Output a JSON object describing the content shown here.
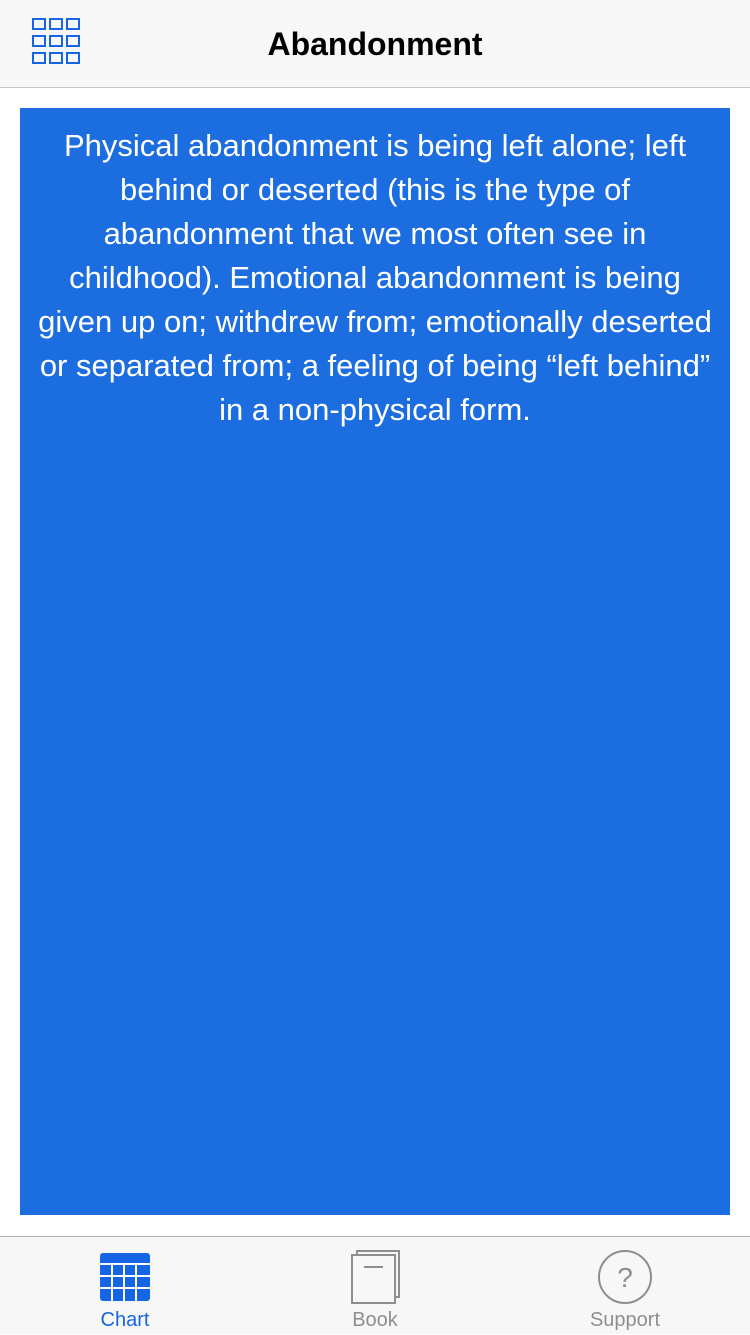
{
  "navbar": {
    "title": "Abandonment",
    "menu_icon": "grid-icon"
  },
  "content": {
    "description": "Physical abandonment is being left alone; left behind or deserted (this is the type of abandonment that we most often see in childhood). Emotional abandonment is being given up on; withdrew from; emotionally deserted or separated from; a feeling of being “left behind” in a non-physical form.",
    "background_color": "#1c6ddf"
  },
  "tabbar": {
    "tabs": [
      {
        "label": "Chart",
        "icon": "chart-grid-icon",
        "selected": true
      },
      {
        "label": "Book",
        "icon": "book-icon",
        "selected": false
      },
      {
        "label": "Support",
        "icon": "question-circle-icon",
        "selected": false
      }
    ],
    "active_color": "#1565e5",
    "inactive_color": "#8e8e8e"
  }
}
